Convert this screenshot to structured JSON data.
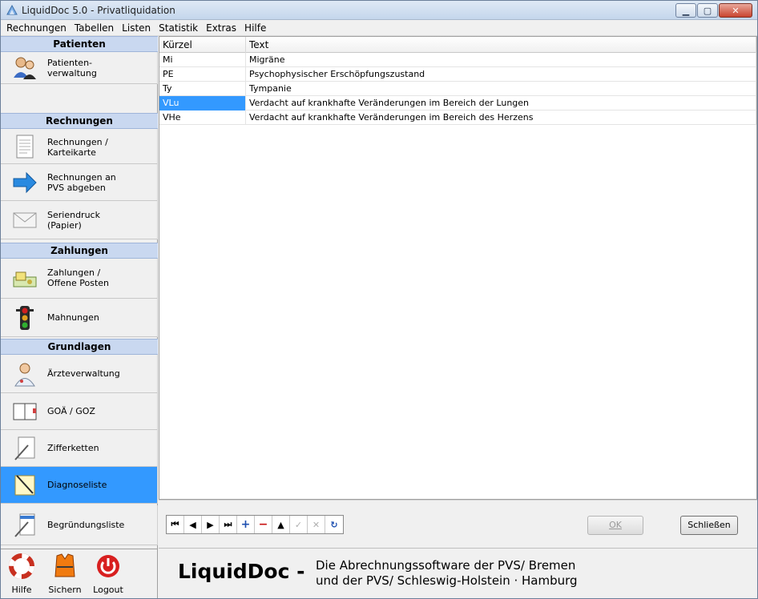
{
  "window": {
    "title": "LiquidDoc 5.0 - Privatliquidation",
    "controls": {
      "minimize": "▁",
      "maximize": "▢",
      "close": "✕"
    }
  },
  "menu": [
    "Rechnungen",
    "Tabellen",
    "Listen",
    "Statistik",
    "Extras",
    "Hilfe"
  ],
  "sidebar": {
    "groups": {
      "patienten": "Patienten",
      "rechnungen": "Rechnungen",
      "zahlungen": "Zahlungen",
      "grundlagen": "Grundlagen"
    },
    "items": {
      "patientenverwaltung": "Patienten-\nverwaltung",
      "rechnungen_karteikarte": "Rechnungen /\nKarteikarte",
      "rechnungen_pvs": "Rechnungen an\nPVS abgeben",
      "seriendruck": "Seriendruck\n(Papier)",
      "zahlungen_offene": "Zahlungen /\nOffene Posten",
      "mahnungen": "Mahnungen",
      "aerzteverwaltung": "Ärzteverwaltung",
      "goae_goz": "GOÄ / GOZ",
      "zifferketten": "Zifferketten",
      "diagnoseliste": "Diagnoseliste",
      "begruendungsliste": "Begründungsliste"
    },
    "selected_item": "Diagnoseliste",
    "bottom_tools": [
      "Hilfe",
      "Sichern",
      "Logout"
    ]
  },
  "grid": {
    "columns": [
      "Kürzel",
      "Text"
    ],
    "rows": [
      [
        "Mi",
        "Migräne"
      ],
      [
        "PE",
        "Psychophysischer Erschöpfungszustand"
      ],
      [
        "Ty",
        "Tympanie"
      ],
      [
        "VLu",
        "Verdacht auf krankhafte Veränderungen im Bereich der Lungen"
      ],
      [
        "VHe",
        "Verdacht auf krankhafte Veränderungen im Bereich des Herzens"
      ]
    ],
    "selected_row": 3
  },
  "navigator": {
    "buttons": [
      "⏮",
      "◀",
      "▶",
      "⏭",
      "+",
      "−",
      "▲",
      "✓",
      "✕",
      "↻"
    ]
  },
  "buttons": {
    "ok": "OK",
    "close": "Schließen"
  },
  "footer": {
    "brand": "LiquidDoc -",
    "tagline_line1": "Die Abrechnungssoftware der PVS/ Bremen",
    "tagline_line2": "und der PVS/ Schleswig-Holstein · Hamburg"
  }
}
